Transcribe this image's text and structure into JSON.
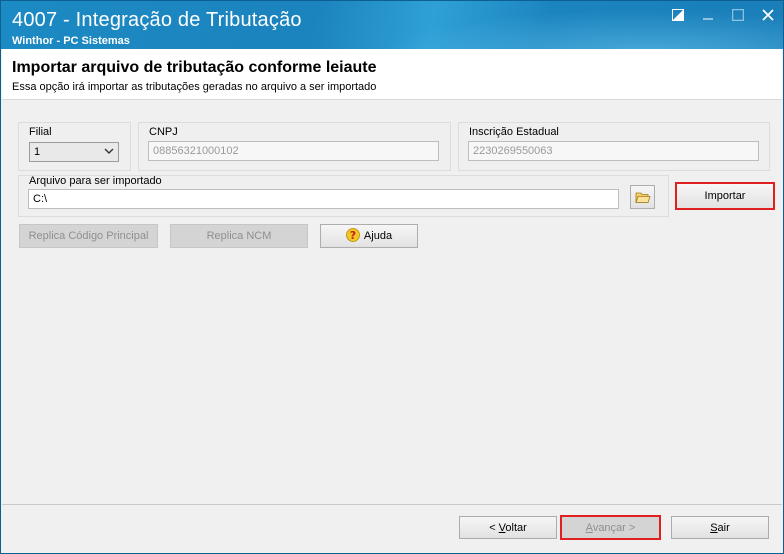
{
  "window": {
    "title": "4007 - Integração de Tributação",
    "subtitle": "Winthor - PC Sistemas",
    "controls": [
      "restore-icon",
      "minimize-icon",
      "maximize-icon",
      "close-icon"
    ]
  },
  "header": {
    "title": "Importar arquivo de tributação conforme leiaute",
    "description": "Essa opção irá importar as tributações geradas no arquivo a ser importado"
  },
  "filial": {
    "label": "Filial",
    "value": "1"
  },
  "cnpj": {
    "label": "CNPJ",
    "value": "08856321000102"
  },
  "inscricao": {
    "label": "Inscrição Estadual",
    "value": "2230269550063"
  },
  "arquivo": {
    "label": "Arquivo para ser importado",
    "value": "C:\\"
  },
  "buttons": {
    "importar": "Importar",
    "replica_codigo": "Replica Código Principal",
    "replica_ncm": "Replica NCM",
    "ajuda": "Ajuda"
  },
  "footer": {
    "voltar_prefix": "< ",
    "voltar_hotkey": "V",
    "voltar_rest": "oltar",
    "avancar_hotkey": "A",
    "avancar_rest": "vançar >",
    "sair_hotkey": "S",
    "sair_rest": "air"
  },
  "colors": {
    "titlebar": "#1c8ac4",
    "highlight": "#e02020"
  }
}
